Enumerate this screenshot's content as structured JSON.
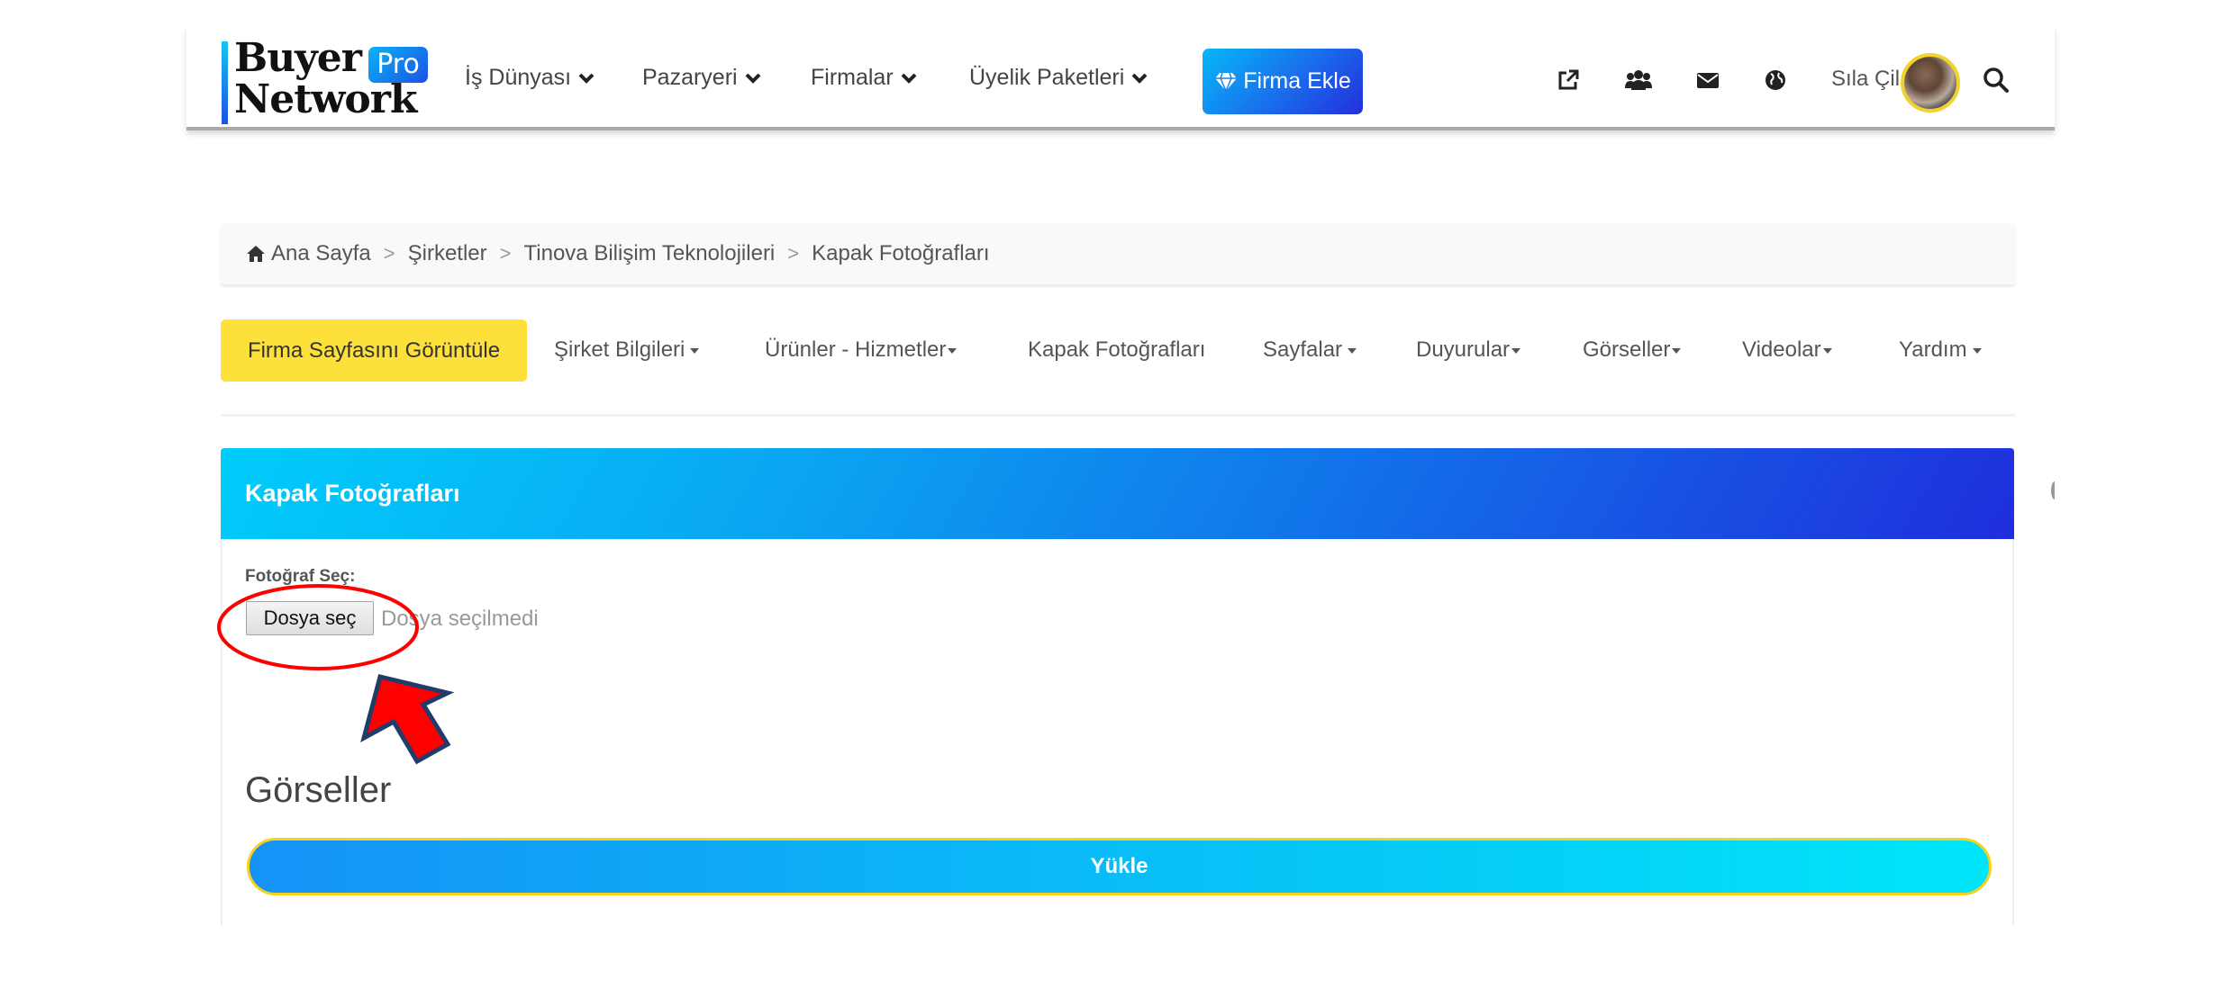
{
  "header": {
    "logo": {
      "line1": "Buyer",
      "line2": "Network",
      "badge": "Pro"
    },
    "nav": [
      {
        "label": "İş Dünyası",
        "icon": "chevron-down-icon"
      },
      {
        "label": "Pazaryeri",
        "icon": "chevron-down-icon"
      },
      {
        "label": "Firmalar",
        "icon": "chevron-down-icon"
      },
      {
        "label": "Üyelik Paketleri",
        "icon": "chevron-down-icon"
      }
    ],
    "cta": {
      "label": "Firma Ekle",
      "icon": "diamond-icon"
    },
    "icons": [
      "external-link-icon",
      "users-icon",
      "envelope-icon",
      "globe-icon"
    ],
    "user_name": "Sıla Çil",
    "search_icon": "search-icon"
  },
  "breadcrumb": [
    {
      "label": "Ana Sayfa",
      "icon": "home-icon"
    },
    {
      "label": "Şirketler"
    },
    {
      "label": "Tinova Bilişim Teknolojileri"
    },
    {
      "label": "Kapak Fotoğrafları"
    }
  ],
  "breadcrumb_separator": ">",
  "tabs": {
    "primary": "Firma Sayfasını Görüntüle",
    "items": [
      {
        "label": "Şirket Bilgileri",
        "dropdown": true
      },
      {
        "label": "Ürünler - Hizmetler",
        "dropdown": true
      },
      {
        "label": "Kapak Fotoğrafları",
        "dropdown": false
      },
      {
        "label": "Sayfalar",
        "dropdown": true
      },
      {
        "label": "Duyurular",
        "dropdown": true
      },
      {
        "label": "Görseller",
        "dropdown": true
      },
      {
        "label": "Videolar",
        "dropdown": true
      },
      {
        "label": "Yardım",
        "dropdown": true
      }
    ]
  },
  "card": {
    "title": "Kapak Fotoğrafları",
    "field_label": "Fotoğraf Seç:",
    "file_button": "Dosya seç",
    "file_status": "Dosya seçilmedi",
    "section_title": "Görseller",
    "upload_button": "Yükle"
  },
  "colors": {
    "accent_yellow": "#fde03a",
    "brand_blue": "#1f2edc",
    "brand_cyan": "#00cdfb",
    "annotation_red": "#ff0000"
  },
  "annotations": {
    "highlight": "red-ellipse around file button",
    "pointer": "red-arrow pointing to file button"
  }
}
